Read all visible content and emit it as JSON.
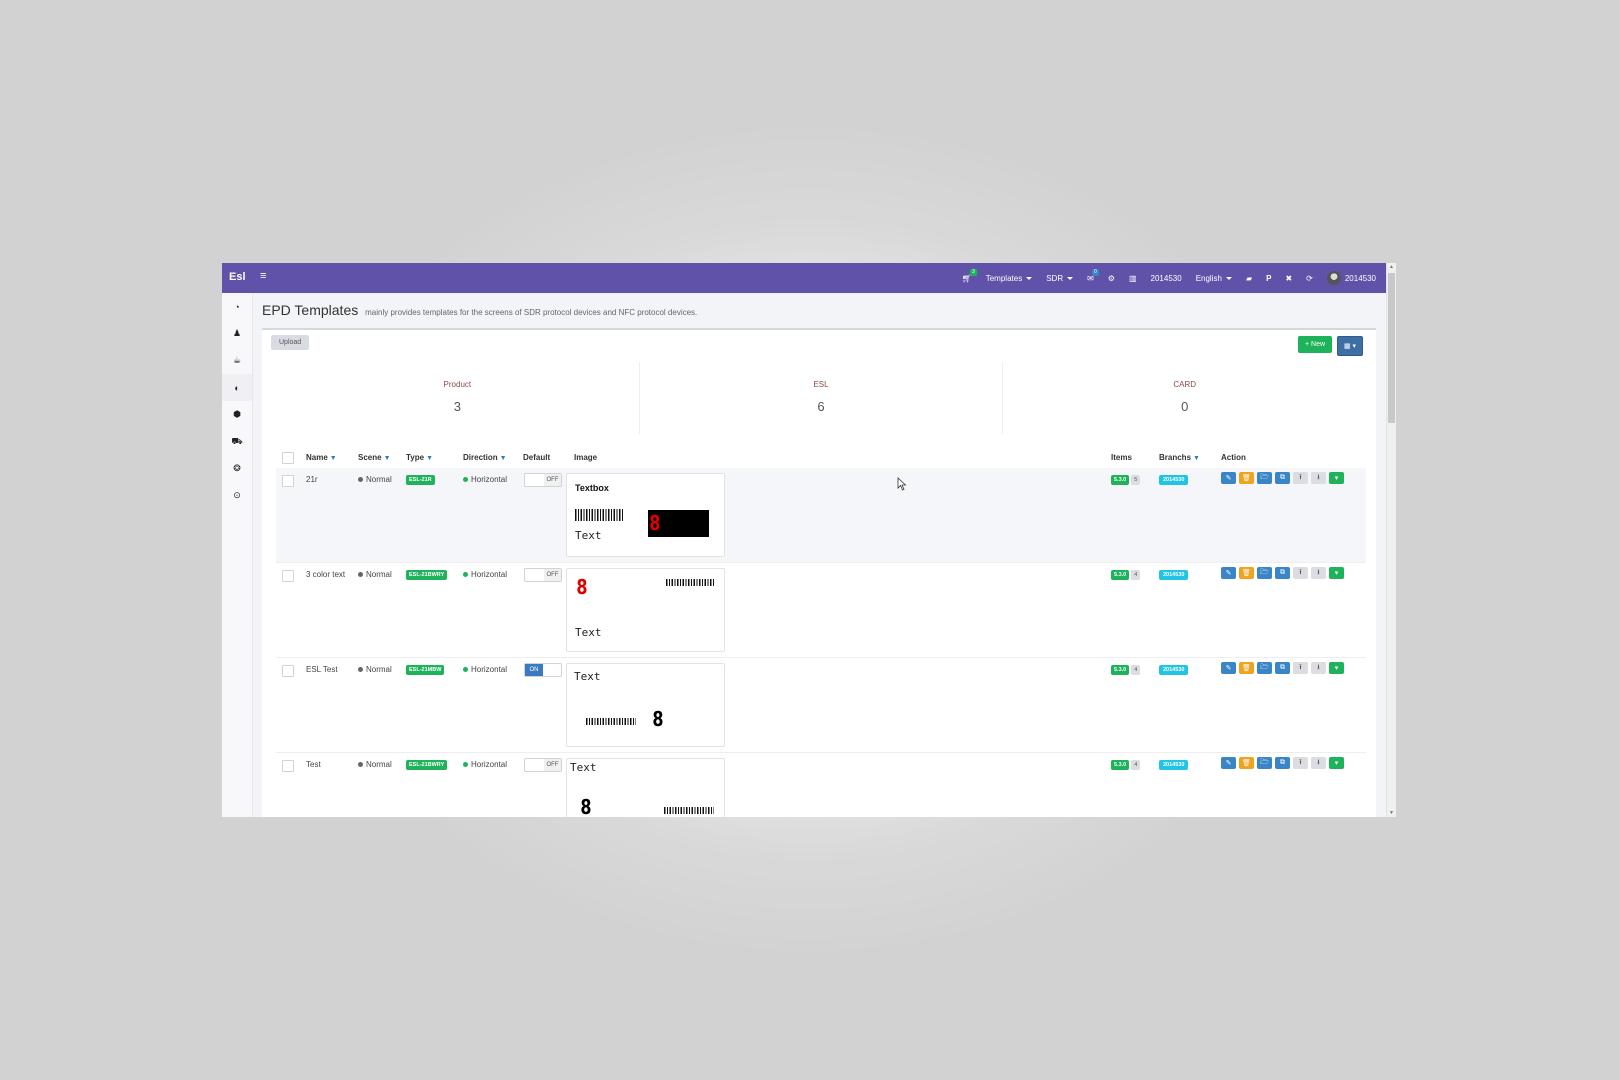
{
  "app": {
    "brand": "Esl"
  },
  "topbar": {
    "cart_badge": "3",
    "templates_label": "Templates",
    "protocol_label": "SDR",
    "messages_badge": "0",
    "store_code": "2014530",
    "language": "English",
    "user_name": "2014530"
  },
  "sidebar": {
    "items": [
      {
        "icon": "dashboard-icon",
        "glyph": "◔"
      },
      {
        "icon": "users-icon",
        "glyph": "👥"
      },
      {
        "icon": "coffee-icon",
        "glyph": "☕"
      },
      {
        "icon": "adjust-icon",
        "glyph": "◐",
        "active": true
      },
      {
        "icon": "cube-icon",
        "glyph": "⬢"
      },
      {
        "icon": "cart-icon",
        "glyph": "🛒"
      },
      {
        "icon": "gear-cluster-icon",
        "glyph": "❂"
      },
      {
        "icon": "clock-icon",
        "glyph": "⊙"
      }
    ]
  },
  "page": {
    "title": "EPD Templates",
    "subtitle": "mainly provides templates for the screens of SDR protocol devices and NFC protocol devices."
  },
  "toolbar": {
    "upload_label": "Upload",
    "new_label": "+ New",
    "columns_label": "▦ ▾"
  },
  "stats": [
    {
      "label": "Product",
      "value": "3"
    },
    {
      "label": "ESL",
      "value": "6"
    },
    {
      "label": "CARD",
      "value": "0"
    }
  ],
  "table": {
    "headers": {
      "name": "Name",
      "scene": "Scene",
      "type": "Type",
      "direction": "Direction",
      "default": "Default",
      "image": "Image",
      "items": "Items",
      "branchs": "Branchs",
      "action": "Action"
    },
    "rows": [
      {
        "name": "21r",
        "scene": "Normal",
        "type": "ESL-21R",
        "direction": "Horizontal",
        "default": "OFF",
        "version": "5.3.0",
        "count": "5",
        "branch": "2014530",
        "preview": {
          "title": "Textbox",
          "text": "Text",
          "digit": "8"
        }
      },
      {
        "name": "3 color text",
        "scene": "Normal",
        "type": "ESL-21BWRY",
        "direction": "Horizontal",
        "default": "OFF",
        "version": "5.3.0",
        "count": "4",
        "branch": "2014530",
        "preview": {
          "text": "Text",
          "digit": "8"
        }
      },
      {
        "name": "ESL Test",
        "scene": "Normal",
        "type": "ESL-21MBW",
        "direction": "Horizontal",
        "default": "ON",
        "version": "5.3.0",
        "count": "4",
        "branch": "2014530",
        "preview": {
          "text": "Text",
          "digit": "8"
        }
      },
      {
        "name": "Test",
        "scene": "Normal",
        "type": "ESL-21BWRY",
        "direction": "Horizontal",
        "default": "OFF",
        "version": "5.3.0",
        "count": "4",
        "branch": "2014530",
        "preview": {
          "text": "Text",
          "digit": "8"
        }
      }
    ]
  },
  "colors": {
    "topbar": "#6052a8",
    "success": "#1eb35a",
    "info": "#22c4e4",
    "primary": "#3a85c6",
    "warning": "#f0a31e",
    "preview_red": "#e00000"
  }
}
